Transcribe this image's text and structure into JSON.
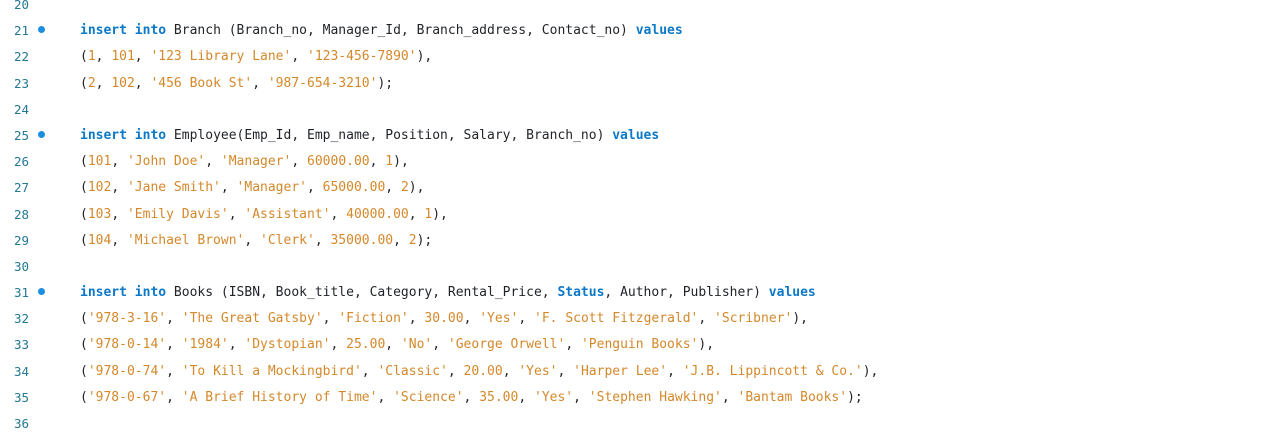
{
  "colors": {
    "keyword": "#0b78c8",
    "string": "#d4882a",
    "number": "#d4882a",
    "text": "#1f2328",
    "line_number": "#237893",
    "breakpoint_dot": "#1a8fe0"
  },
  "lines": [
    {
      "num": "20",
      "dot": false,
      "tokens": []
    },
    {
      "num": "21",
      "dot": true,
      "tokens": [
        {
          "t": "kw",
          "v": "insert"
        },
        {
          "t": "txt",
          "v": " "
        },
        {
          "t": "kw",
          "v": "into"
        },
        {
          "t": "txt",
          "v": " Branch (Branch_no, Manager_Id, Branch_address, Contact_no) "
        },
        {
          "t": "kw",
          "v": "values"
        }
      ]
    },
    {
      "num": "22",
      "dot": false,
      "tokens": [
        {
          "t": "txt",
          "v": "("
        },
        {
          "t": "numv",
          "v": "1"
        },
        {
          "t": "txt",
          "v": ", "
        },
        {
          "t": "numv",
          "v": "101"
        },
        {
          "t": "txt",
          "v": ", "
        },
        {
          "t": "str",
          "v": "'123 Library Lane'"
        },
        {
          "t": "txt",
          "v": ", "
        },
        {
          "t": "str",
          "v": "'123-456-7890'"
        },
        {
          "t": "txt",
          "v": "),"
        }
      ]
    },
    {
      "num": "23",
      "dot": false,
      "tokens": [
        {
          "t": "txt",
          "v": "("
        },
        {
          "t": "numv",
          "v": "2"
        },
        {
          "t": "txt",
          "v": ", "
        },
        {
          "t": "numv",
          "v": "102"
        },
        {
          "t": "txt",
          "v": ", "
        },
        {
          "t": "str",
          "v": "'456 Book St'"
        },
        {
          "t": "txt",
          "v": ", "
        },
        {
          "t": "str",
          "v": "'987-654-3210'"
        },
        {
          "t": "txt",
          "v": ");"
        }
      ]
    },
    {
      "num": "24",
      "dot": false,
      "tokens": []
    },
    {
      "num": "25",
      "dot": true,
      "tokens": [
        {
          "t": "kw",
          "v": "insert"
        },
        {
          "t": "txt",
          "v": " "
        },
        {
          "t": "kw",
          "v": "into"
        },
        {
          "t": "txt",
          "v": " Employee(Emp_Id, Emp_name, Position, Salary, Branch_no) "
        },
        {
          "t": "kw",
          "v": "values"
        }
      ]
    },
    {
      "num": "26",
      "dot": false,
      "tokens": [
        {
          "t": "txt",
          "v": "("
        },
        {
          "t": "numv",
          "v": "101"
        },
        {
          "t": "txt",
          "v": ", "
        },
        {
          "t": "str",
          "v": "'John Doe'"
        },
        {
          "t": "txt",
          "v": ", "
        },
        {
          "t": "str",
          "v": "'Manager'"
        },
        {
          "t": "txt",
          "v": ", "
        },
        {
          "t": "numv",
          "v": "60000.00"
        },
        {
          "t": "txt",
          "v": ", "
        },
        {
          "t": "numv",
          "v": "1"
        },
        {
          "t": "txt",
          "v": "),"
        }
      ]
    },
    {
      "num": "27",
      "dot": false,
      "tokens": [
        {
          "t": "txt",
          "v": "("
        },
        {
          "t": "numv",
          "v": "102"
        },
        {
          "t": "txt",
          "v": ", "
        },
        {
          "t": "str",
          "v": "'Jane Smith'"
        },
        {
          "t": "txt",
          "v": ", "
        },
        {
          "t": "str",
          "v": "'Manager'"
        },
        {
          "t": "txt",
          "v": ", "
        },
        {
          "t": "numv",
          "v": "65000.00"
        },
        {
          "t": "txt",
          "v": ", "
        },
        {
          "t": "numv",
          "v": "2"
        },
        {
          "t": "txt",
          "v": "),"
        }
      ]
    },
    {
      "num": "28",
      "dot": false,
      "tokens": [
        {
          "t": "txt",
          "v": "("
        },
        {
          "t": "numv",
          "v": "103"
        },
        {
          "t": "txt",
          "v": ", "
        },
        {
          "t": "str",
          "v": "'Emily Davis'"
        },
        {
          "t": "txt",
          "v": ", "
        },
        {
          "t": "str",
          "v": "'Assistant'"
        },
        {
          "t": "txt",
          "v": ", "
        },
        {
          "t": "numv",
          "v": "40000.00"
        },
        {
          "t": "txt",
          "v": ", "
        },
        {
          "t": "numv",
          "v": "1"
        },
        {
          "t": "txt",
          "v": "),"
        }
      ]
    },
    {
      "num": "29",
      "dot": false,
      "tokens": [
        {
          "t": "txt",
          "v": "("
        },
        {
          "t": "numv",
          "v": "104"
        },
        {
          "t": "txt",
          "v": ", "
        },
        {
          "t": "str",
          "v": "'Michael Brown'"
        },
        {
          "t": "txt",
          "v": ", "
        },
        {
          "t": "str",
          "v": "'Clerk'"
        },
        {
          "t": "txt",
          "v": ", "
        },
        {
          "t": "numv",
          "v": "35000.00"
        },
        {
          "t": "txt",
          "v": ", "
        },
        {
          "t": "numv",
          "v": "2"
        },
        {
          "t": "txt",
          "v": ");"
        }
      ]
    },
    {
      "num": "30",
      "dot": false,
      "tokens": []
    },
    {
      "num": "31",
      "dot": true,
      "tokens": [
        {
          "t": "kw",
          "v": "insert"
        },
        {
          "t": "txt",
          "v": " "
        },
        {
          "t": "kw",
          "v": "into"
        },
        {
          "t": "txt",
          "v": " Books (ISBN, Book_title, Category, Rental_Price, "
        },
        {
          "t": "kw",
          "v": "Status"
        },
        {
          "t": "txt",
          "v": ", Author, Publisher) "
        },
        {
          "t": "kw",
          "v": "values"
        }
      ]
    },
    {
      "num": "32",
      "dot": false,
      "tokens": [
        {
          "t": "txt",
          "v": "("
        },
        {
          "t": "str",
          "v": "'978-3-16'"
        },
        {
          "t": "txt",
          "v": ", "
        },
        {
          "t": "str",
          "v": "'The Great Gatsby'"
        },
        {
          "t": "txt",
          "v": ", "
        },
        {
          "t": "str",
          "v": "'Fiction'"
        },
        {
          "t": "txt",
          "v": ", "
        },
        {
          "t": "numv",
          "v": "30.00"
        },
        {
          "t": "txt",
          "v": ", "
        },
        {
          "t": "str",
          "v": "'Yes'"
        },
        {
          "t": "txt",
          "v": ", "
        },
        {
          "t": "str",
          "v": "'F. Scott Fitzgerald'"
        },
        {
          "t": "txt",
          "v": ", "
        },
        {
          "t": "str",
          "v": "'Scribner'"
        },
        {
          "t": "txt",
          "v": "),"
        }
      ]
    },
    {
      "num": "33",
      "dot": false,
      "tokens": [
        {
          "t": "txt",
          "v": "("
        },
        {
          "t": "str",
          "v": "'978-0-14'"
        },
        {
          "t": "txt",
          "v": ", "
        },
        {
          "t": "str",
          "v": "'1984'"
        },
        {
          "t": "txt",
          "v": ", "
        },
        {
          "t": "str",
          "v": "'Dystopian'"
        },
        {
          "t": "txt",
          "v": ", "
        },
        {
          "t": "numv",
          "v": "25.00"
        },
        {
          "t": "txt",
          "v": ", "
        },
        {
          "t": "str",
          "v": "'No'"
        },
        {
          "t": "txt",
          "v": ", "
        },
        {
          "t": "str",
          "v": "'George Orwell'"
        },
        {
          "t": "txt",
          "v": ", "
        },
        {
          "t": "str",
          "v": "'Penguin Books'"
        },
        {
          "t": "txt",
          "v": "),"
        }
      ]
    },
    {
      "num": "34",
      "dot": false,
      "tokens": [
        {
          "t": "txt",
          "v": "("
        },
        {
          "t": "str",
          "v": "'978-0-74'"
        },
        {
          "t": "txt",
          "v": ", "
        },
        {
          "t": "str",
          "v": "'To Kill a Mockingbird'"
        },
        {
          "t": "txt",
          "v": ", "
        },
        {
          "t": "str",
          "v": "'Classic'"
        },
        {
          "t": "txt",
          "v": ", "
        },
        {
          "t": "numv",
          "v": "20.00"
        },
        {
          "t": "txt",
          "v": ", "
        },
        {
          "t": "str",
          "v": "'Yes'"
        },
        {
          "t": "txt",
          "v": ", "
        },
        {
          "t": "str",
          "v": "'Harper Lee'"
        },
        {
          "t": "txt",
          "v": ", "
        },
        {
          "t": "str",
          "v": "'J.B. Lippincott & Co.'"
        },
        {
          "t": "txt",
          "v": "),"
        }
      ]
    },
    {
      "num": "35",
      "dot": false,
      "tokens": [
        {
          "t": "txt",
          "v": "("
        },
        {
          "t": "str",
          "v": "'978-0-67'"
        },
        {
          "t": "txt",
          "v": ", "
        },
        {
          "t": "str",
          "v": "'A Brief History of Time'"
        },
        {
          "t": "txt",
          "v": ", "
        },
        {
          "t": "str",
          "v": "'Science'"
        },
        {
          "t": "txt",
          "v": ", "
        },
        {
          "t": "numv",
          "v": "35.00"
        },
        {
          "t": "txt",
          "v": ", "
        },
        {
          "t": "str",
          "v": "'Yes'"
        },
        {
          "t": "txt",
          "v": ", "
        },
        {
          "t": "str",
          "v": "'Stephen Hawking'"
        },
        {
          "t": "txt",
          "v": ", "
        },
        {
          "t": "str",
          "v": "'Bantam Books'"
        },
        {
          "t": "txt",
          "v": ");"
        }
      ]
    },
    {
      "num": "36",
      "dot": false,
      "tokens": []
    }
  ]
}
